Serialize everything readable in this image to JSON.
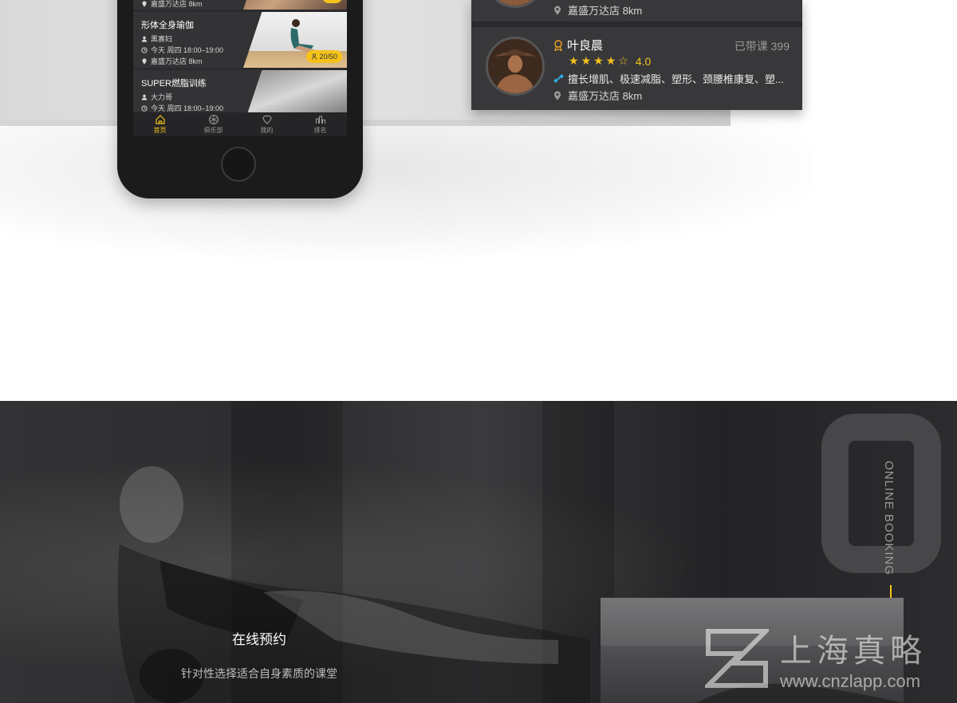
{
  "phone": {
    "courses": [
      {
        "title": "",
        "instructor": "",
        "time": "",
        "location": "嘉盛万达店 8km",
        "capacity": ""
      },
      {
        "title": "形体全身瑜伽",
        "instructor": "黑寡妇",
        "time": "今天 周四 18:00–19:00",
        "location": "嘉盛万达店 8km",
        "capacity": "20/50"
      },
      {
        "title": "SUPER燃脂训练",
        "instructor": "大力哥",
        "time": "今天 周四 18:00–19:00",
        "location": "",
        "capacity": ""
      }
    ],
    "tabs": [
      {
        "label": "首页",
        "icon": "home-icon",
        "active": true
      },
      {
        "label": "俱乐部",
        "icon": "club-icon",
        "active": false
      },
      {
        "label": "我的",
        "icon": "user-icon",
        "active": false
      },
      {
        "label": "排名",
        "icon": "ranking-icon",
        "active": false
      }
    ]
  },
  "coach_card": {
    "first_location": "嘉盛万达店 8km",
    "coach": {
      "name": "叶良晨",
      "count": "已带课 399",
      "rating": "4.0",
      "stars_filled": 4,
      "stars_total": 5,
      "skills": "擅长增肌、极速减脂、塑形、颈腰椎康复、塑...",
      "location": "嘉盛万达店 8km"
    }
  },
  "section": {
    "vertical_label": "ONLINE BOOKING",
    "title": "在线预约",
    "subtitle": "针对性选择适合自身素质的课堂"
  },
  "watermark": {
    "cn": "上海真略",
    "url": "www.cnzlapp.com"
  },
  "colors": {
    "accent": "#f5c21b",
    "card": "#38383b",
    "dark_bg": "#2b2b2d"
  }
}
